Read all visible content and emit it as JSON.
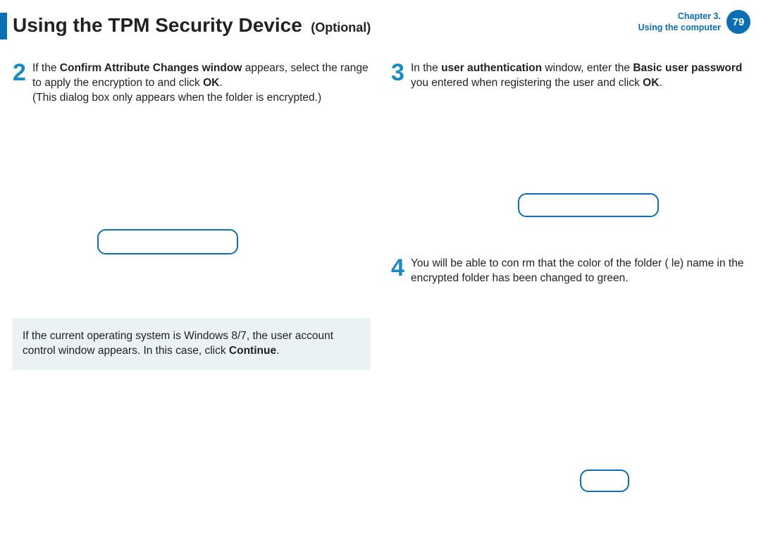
{
  "header": {
    "title": "Using the TPM Security Device",
    "optional": "(Optional)",
    "chapter_line1": "Chapter 3.",
    "chapter_line2": "Using the computer",
    "page": "79"
  },
  "left": {
    "step2": {
      "num": "2",
      "t1": "If the ",
      "b1": "Confirm Attribute Changes window",
      "t2": " appears, select the range to apply the encryption to and click ",
      "b2": "OK",
      "t3": ".",
      "line2": "(This dialog box only appears when the folder is encrypted.)"
    },
    "note": {
      "t1": "If the current operating system is Windows 8/7, the user account control window appears. In this case, click ",
      "b1": "Continue",
      "t2": "."
    }
  },
  "right": {
    "step3": {
      "num": "3",
      "t1": "In the ",
      "b1": "user authentication",
      "t2": " window, enter the ",
      "b2": "Basic user password",
      "t3": " you entered when registering the user and click ",
      "b3": "OK",
      "t4": "."
    },
    "step4": {
      "num": "4",
      "text": "You will be able to con rm that the color of the folder ( le) name in the encrypted folder has been changed to green."
    }
  }
}
